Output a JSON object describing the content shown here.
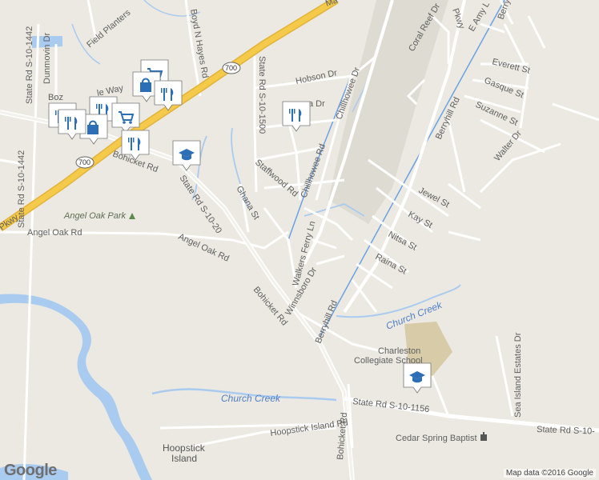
{
  "map": {
    "attribution": "Map data ©2016 Google",
    "logo": "Google",
    "colors": {
      "background": "#ece9e2",
      "water": "#a9cbf0",
      "highway": "#f5c94a",
      "road": "#ffffff",
      "poi_marker": "#ffffff",
      "poi_icon": "#2d6fb7",
      "school_area": "#d8cba8"
    }
  },
  "roads": {
    "state_rd_1442_top": "State Rd S-10-1442",
    "state_rd_1442_mid": "State Rd S-10-1442",
    "dunmovin": "Dunmovin Dr",
    "field_planters": "Field Planters",
    "boyd_hayes": "Boyd N Hayes Rd",
    "hwy_700_top": "700",
    "hwy_700_left": "700",
    "state_rd_1500": "State Rd S-10-1500",
    "hobson": "Hobson Dr",
    "coral_reef": "Coral Reef Dr",
    "e_amy": "E Amy L",
    "pkwy": "Pkwy",
    "berryhill_top": "Berryh",
    "maybank_partial": "Ma",
    "everett": "Everett St",
    "gasque": "Gasque St",
    "suzanne": "Suzanne St",
    "berryhill_rd": "Berryhill Rd",
    "chillhowee_top": "Chillhowee Dr",
    "chillhowee_rd": "Chillhowee Rd",
    "arya_partial": "a Dr",
    "staffwood": "Staffwood Rd",
    "walter": "Walter Dr",
    "jewel": "Jewel St",
    "kay": "Kay St",
    "nitsa": "Nitsa St",
    "raina": "Raina St",
    "walkers_ferry": "Walkers Ferry Ln",
    "winnsboro": "Winnsboro Dr",
    "ghana": "Ghana St",
    "state_rd_1020": "State Rd S-10-20",
    "angel_oak_rd_left": "Angel Oak Rd",
    "angel_oak_rd_right": "Angel Oak Rd",
    "bohicket_mid": "Bohicket Rd",
    "bohicket_bottom": "Bohicket Rd",
    "berryhill_lower": "Berryhill Rd",
    "state_rd_1156": "State Rd S-10-1156",
    "state_rd_1156_right": "State Rd S-10-",
    "sea_island_estates": "Sea Island Estates Dr",
    "hoopstick_island_rd": "Hoopstick Island Rd",
    "parkway_left": "Pkwy",
    "bohicket_upper": "Bohicket Rd",
    "whittle_way": "le Way",
    "boz": "Boz"
  },
  "places": {
    "angel_oak_park": "Angel Oak Park",
    "charleston_school_line1": "Charleston",
    "charleston_school_line2": "Collegiate School",
    "cedar_spring": "Cedar Spring Baptist",
    "hoopstick_line1": "Hoopstick",
    "hoopstick_line2": "Island"
  },
  "water": {
    "church_creek_right": "Church Creek",
    "church_creek_bottom": "Church Creek"
  },
  "markers": [
    {
      "icon": "shopping-cart-icon"
    },
    {
      "icon": "shopping-bag-icon"
    },
    {
      "icon": "restaurant-icon"
    },
    {
      "icon": "restaurant-icon"
    },
    {
      "icon": "restaurant-icon"
    },
    {
      "icon": "shopping-bag-icon"
    },
    {
      "icon": "shopping-cart-icon"
    },
    {
      "icon": "restaurant-icon"
    },
    {
      "icon": "restaurant-icon"
    },
    {
      "icon": "school-icon"
    },
    {
      "icon": "restaurant-icon"
    },
    {
      "icon": "school-icon"
    }
  ]
}
